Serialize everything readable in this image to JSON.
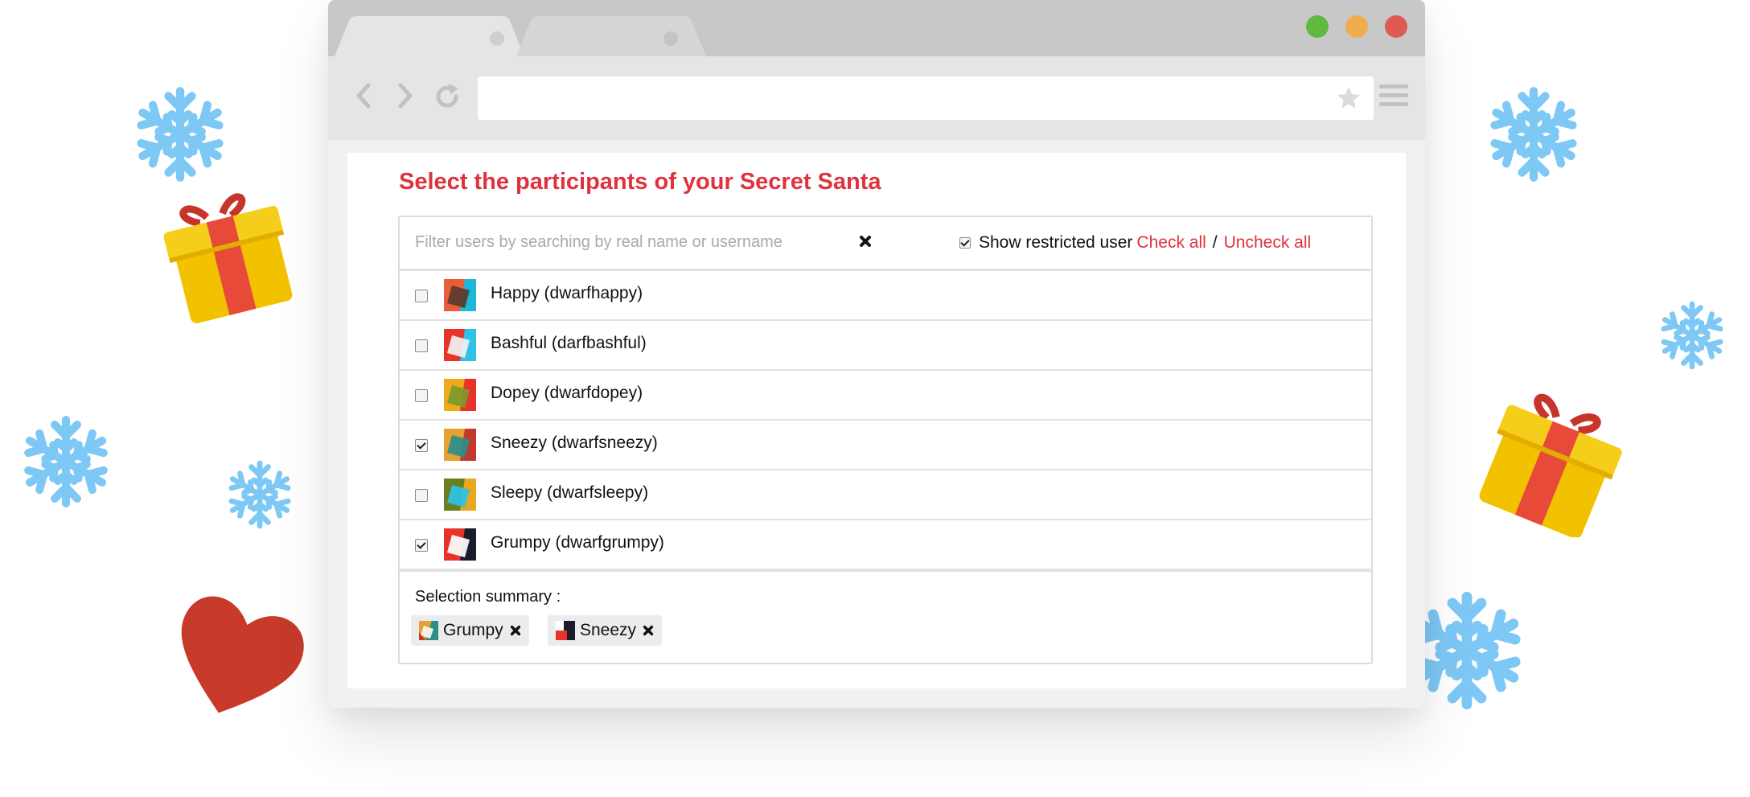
{
  "browser": {
    "window_buttons": [
      {
        "name": "green",
        "color": "#61b840"
      },
      {
        "name": "orange",
        "color": "#f0ad4e"
      },
      {
        "name": "red",
        "color": "#e05a52"
      }
    ],
    "url_value": ""
  },
  "page": {
    "heading": "Select the participants of your Secret Santa",
    "accent_color": "#e0313e"
  },
  "filter": {
    "placeholder": "Filter users by searching by real name or username",
    "value": "",
    "show_restricted_label": "Show restricted user",
    "show_restricted_checked": true,
    "check_all_label": "Check all",
    "separator": "/",
    "uncheck_all_label": "Uncheck all"
  },
  "users": [
    {
      "label": "Happy (dwarfhappy)",
      "checked": false,
      "avatar_colors": [
        "#e85d3a",
        "#1fb6d8",
        "#5a3a2e"
      ]
    },
    {
      "label": "Bashful (darfbashful)",
      "checked": false,
      "avatar_colors": [
        "#e8332b",
        "#2ec3e6",
        "#f2f2f2"
      ]
    },
    {
      "label": "Dopey (dwarfdopey)",
      "checked": false,
      "avatar_colors": [
        "#f0a81c",
        "#e8332b",
        "#7a9a2a"
      ]
    },
    {
      "label": "Sneezy (dwarfsneezy)",
      "checked": true,
      "avatar_colors": [
        "#e8a030",
        "#c23a2e",
        "#2a8f8a"
      ]
    },
    {
      "label": "Sleepy (dwarfsleepy)",
      "checked": false,
      "avatar_colors": [
        "#6a7f1e",
        "#e8a81c",
        "#2ec3e6"
      ]
    },
    {
      "label": "Grumpy (dwarfgrumpy)",
      "checked": true,
      "avatar_colors": [
        "#e8332b",
        "#1b1b2e",
        "#ffffff"
      ]
    }
  ],
  "summary": {
    "title": "Selection summary :",
    "chips": [
      {
        "label": "Grumpy",
        "remove_icon": "close-icon"
      },
      {
        "label": "Sneezy",
        "remove_icon": "close-icon"
      }
    ]
  },
  "decorations": {
    "snowflake_color": "#7ec8f6",
    "gift_color": "#f2c200",
    "ribbon_color": "#e84a3a",
    "heart_color": "#c73a2a"
  }
}
